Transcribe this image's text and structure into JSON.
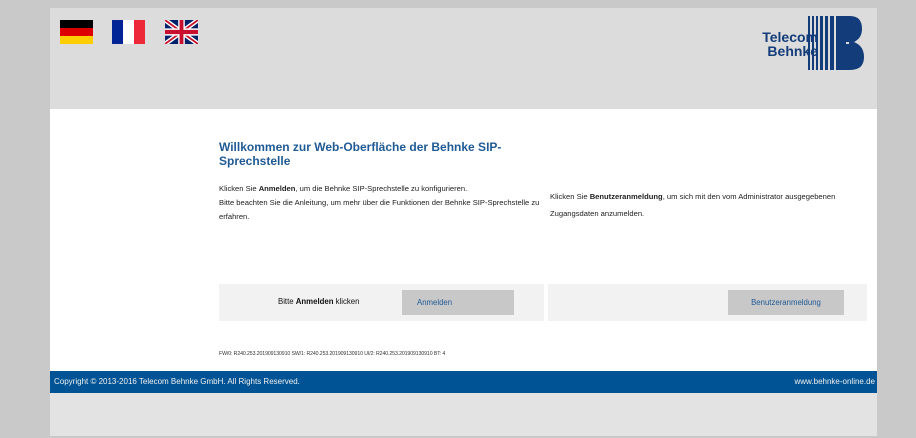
{
  "header": {
    "flags": [
      {
        "name": "german-flag-icon",
        "language": "Deutsch"
      },
      {
        "name": "french-flag-icon",
        "language": "Français"
      },
      {
        "name": "uk-flag-icon",
        "language": "English"
      }
    ],
    "logo_line1": "Telecom",
    "logo_line2": "Behnke"
  },
  "main": {
    "title": "Willkommen zur Web-Oberfläche der Behnke SIP-Sprechstelle",
    "left": {
      "p1_pre": "Klicken Sie ",
      "p1_bold": "Anmelden",
      "p1_post": ", um die Behnke SIP-Sprechstelle zu konfigurieren.",
      "p2": "Bitte beachten Sie die Anleitung, um mehr über die Funktionen der Behnke SIP-Sprechstelle zu erfahren."
    },
    "right": {
      "pre": "Klicken Sie ",
      "bold": "Benutzeranmeldung",
      "post": ", um sich mit den vom Administrator ausgegebenen Zugangsdaten anzumelden."
    },
    "login_prompt_pre": "Bitte ",
    "login_prompt_bold": "Anmelden",
    "login_prompt_post": " klicken",
    "login_button": "Anmelden",
    "user_login_button": "Benutzeranmeldung",
    "firmware": "FW/0: R240.253.201909130910 SW/1: R240.253.201909130910 UI/2: R240.253.201909130910 BT: 4"
  },
  "footer": {
    "copyright": "Copyright © 2013-2016 Telecom Behnke GmbH. All Rights Reserved.",
    "website": "www.behnke-online.de"
  },
  "colors": {
    "accent_blue": "#1f5a95",
    "footer_blue": "#005394",
    "page_bg": "#c9c9c9"
  }
}
